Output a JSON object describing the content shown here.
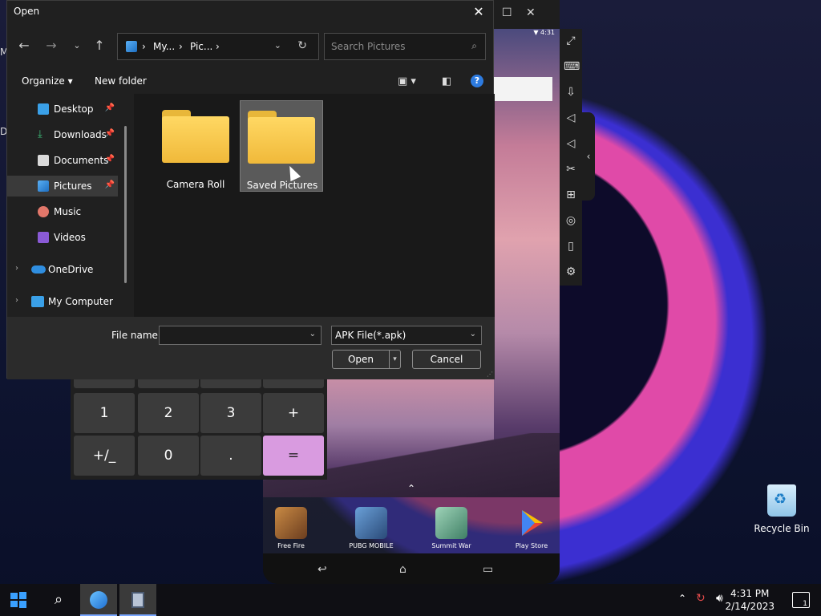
{
  "dialog": {
    "title": "Open",
    "breadcrumb": [
      "My...",
      "Pic..."
    ],
    "search_placeholder": "Search Pictures",
    "organize_label": "Organize",
    "new_folder_label": "New folder",
    "nav_items": [
      {
        "label": "Desktop",
        "pinned": true
      },
      {
        "label": "Downloads",
        "pinned": true
      },
      {
        "label": "Documents",
        "pinned": true
      },
      {
        "label": "Pictures",
        "pinned": true,
        "selected": true
      },
      {
        "label": "Music"
      },
      {
        "label": "Videos"
      },
      {
        "label": "OneDrive",
        "expandable": true
      },
      {
        "label": "My Computer",
        "expandable": true
      }
    ],
    "folders": [
      {
        "label": "Camera Roll"
      },
      {
        "label": "Saved Pictures",
        "selected": true
      }
    ],
    "file_name_label": "File name:",
    "file_name_value": "",
    "file_type": "APK File(*.apk)",
    "open_label": "Open",
    "cancel_label": "Cancel"
  },
  "emulator": {
    "status_time": "4:31",
    "dock_apps": [
      {
        "label": "Free Fire",
        "color": "#b5652a"
      },
      {
        "label": "PUBG MOBILE",
        "color": "#2e5f96"
      },
      {
        "label": "Summit War",
        "color": "#4f9a7b"
      },
      {
        "label": "Play Store",
        "color": "#2a2a2a"
      }
    ]
  },
  "calculator": {
    "keys": [
      "1",
      "2",
      "3",
      "+",
      "+/_",
      "0",
      ".",
      "="
    ]
  },
  "desktop": {
    "recycle_bin_label": "Recycle Bin",
    "edge_fragments": [
      "M",
      "D"
    ]
  },
  "taskbar": {
    "time": "4:31 PM",
    "date": "2/14/2023",
    "notification_count": "1"
  },
  "colors": {
    "folder": "#f0b93a",
    "accent": "#2d7be0",
    "equals_key": "#d99be0"
  }
}
